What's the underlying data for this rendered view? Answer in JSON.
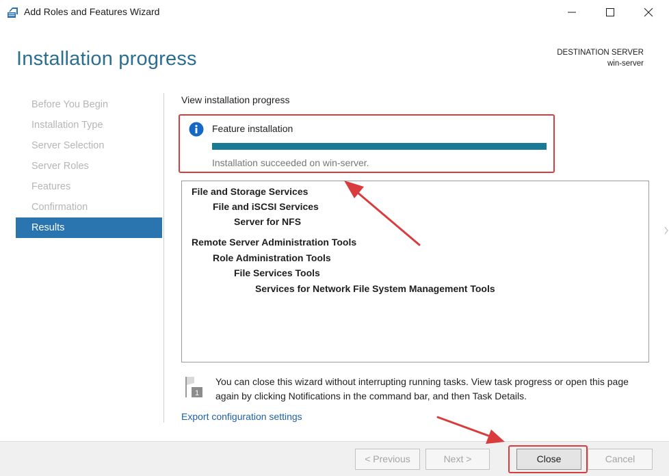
{
  "window": {
    "title": "Add Roles and Features Wizard",
    "icons": {
      "app": "server-manager-icon",
      "minimize": "minimize-icon",
      "maximize": "maximize-icon",
      "close": "close-icon"
    }
  },
  "header": {
    "page_title": "Installation progress",
    "destination_label": "DESTINATION SERVER",
    "destination_server": "win-server"
  },
  "nav": {
    "steps": [
      {
        "label": "Before You Begin",
        "active": false
      },
      {
        "label": "Installation Type",
        "active": false
      },
      {
        "label": "Server Selection",
        "active": false
      },
      {
        "label": "Server Roles",
        "active": false
      },
      {
        "label": "Features",
        "active": false
      },
      {
        "label": "Confirmation",
        "active": false
      },
      {
        "label": "Results",
        "active": true
      }
    ]
  },
  "progress": {
    "section_label": "View installation progress",
    "title": "Feature installation",
    "percent": 100,
    "status": "Installation succeeded on win-server.",
    "icon": "info-icon"
  },
  "features": [
    {
      "label": "File and Storage Services",
      "level": 0
    },
    {
      "label": "File and iSCSI Services",
      "level": 1
    },
    {
      "label": "Server for NFS",
      "level": 2
    },
    {
      "label": "Remote Server Administration Tools",
      "level": 0
    },
    {
      "label": "Role Administration Tools",
      "level": 1
    },
    {
      "label": "File Services Tools",
      "level": 2
    },
    {
      "label": "Services for Network File System Management Tools",
      "level": 3
    }
  ],
  "notice": {
    "text": "You can close this wizard without interrupting running tasks. View task progress or open this page again by clicking Notifications in the command bar, and then Task Details.",
    "icon": "notification-flag-icon",
    "flag_number": "1"
  },
  "export_link": "Export configuration settings",
  "buttons": {
    "previous": "< Previous",
    "next": "Next >",
    "close": "Close",
    "cancel": "Cancel"
  },
  "colors": {
    "accent": "#2c6e8f",
    "nav_active": "#2a75b0",
    "progress": "#197a96",
    "annotation": "#d93c3c",
    "link": "#1f5fa6"
  }
}
